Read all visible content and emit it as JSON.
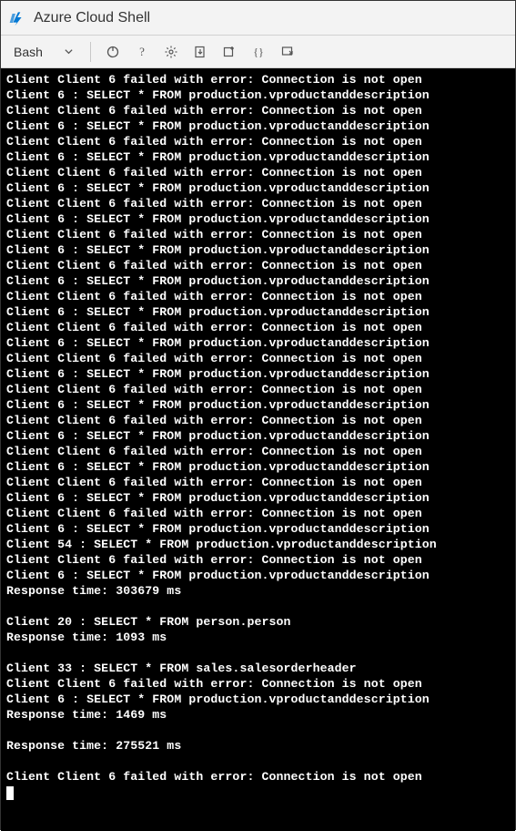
{
  "titlebar": {
    "title": "Azure Cloud Shell"
  },
  "toolbar": {
    "shell_label": "Bash"
  },
  "terminal": {
    "lines": [
      "Client Client 6 failed with error: Connection is not open",
      "Client 6 : SELECT * FROM production.vproductanddescription",
      "Client Client 6 failed with error: Connection is not open",
      "Client 6 : SELECT * FROM production.vproductanddescription",
      "Client Client 6 failed with error: Connection is not open",
      "Client 6 : SELECT * FROM production.vproductanddescription",
      "Client Client 6 failed with error: Connection is not open",
      "Client 6 : SELECT * FROM production.vproductanddescription",
      "Client Client 6 failed with error: Connection is not open",
      "Client 6 : SELECT * FROM production.vproductanddescription",
      "Client Client 6 failed with error: Connection is not open",
      "Client 6 : SELECT * FROM production.vproductanddescription",
      "Client Client 6 failed with error: Connection is not open",
      "Client 6 : SELECT * FROM production.vproductanddescription",
      "Client Client 6 failed with error: Connection is not open",
      "Client 6 : SELECT * FROM production.vproductanddescription",
      "Client Client 6 failed with error: Connection is not open",
      "Client 6 : SELECT * FROM production.vproductanddescription",
      "Client Client 6 failed with error: Connection is not open",
      "Client 6 : SELECT * FROM production.vproductanddescription",
      "Client Client 6 failed with error: Connection is not open",
      "Client 6 : SELECT * FROM production.vproductanddescription",
      "Client Client 6 failed with error: Connection is not open",
      "Client 6 : SELECT * FROM production.vproductanddescription",
      "Client Client 6 failed with error: Connection is not open",
      "Client 6 : SELECT * FROM production.vproductanddescription",
      "Client Client 6 failed with error: Connection is not open",
      "Client 6 : SELECT * FROM production.vproductanddescription",
      "Client Client 6 failed with error: Connection is not open",
      "Client 6 : SELECT * FROM production.vproductanddescription",
      "Client 54 : SELECT * FROM production.vproductanddescription",
      "Client Client 6 failed with error: Connection is not open",
      "Client 6 : SELECT * FROM production.vproductanddescription",
      "Response time: 303679 ms",
      "",
      "Client 20 : SELECT * FROM person.person",
      "Response time: 1093 ms",
      "",
      "Client 33 : SELECT * FROM sales.salesorderheader",
      "Client Client 6 failed with error: Connection is not open",
      "Client 6 : SELECT * FROM production.vproductanddescription",
      "Response time: 1469 ms",
      "",
      "Response time: 275521 ms",
      "",
      "Client Client 6 failed with error: Connection is not open"
    ]
  }
}
